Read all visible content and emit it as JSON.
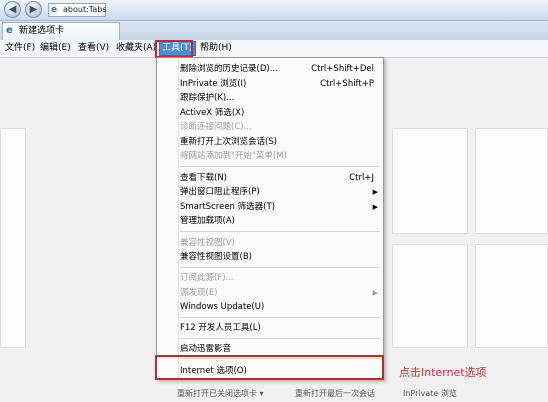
{
  "browser": {
    "address": "about:Tabs",
    "tab_title": "新建选项卡"
  },
  "menubar": {
    "items": [
      "文件(F)",
      "编辑(E)",
      "查看(V)",
      "收藏夹(A)",
      "工具(T)",
      "帮助(H)"
    ]
  },
  "tools_menu": {
    "items": [
      {
        "label": "删除浏览的历史记录(D)...",
        "shortcut": "Ctrl+Shift+Del",
        "disabled": false
      },
      {
        "label": "InPrivate 浏览(I)",
        "shortcut": "Ctrl+Shift+P",
        "disabled": false
      },
      {
        "label": "跟踪保护(K)...",
        "shortcut": "",
        "disabled": false
      },
      {
        "label": "ActiveX 筛选(X)",
        "shortcut": "",
        "disabled": false
      },
      {
        "label": "诊断连接问题(C)...",
        "shortcut": "",
        "disabled": true
      },
      {
        "label": "重新打开上次浏览会话(S)",
        "shortcut": "",
        "disabled": false
      },
      {
        "label": "将网站添加到\"开始\"菜单(M)",
        "shortcut": "",
        "disabled": true
      },
      {
        "label": "查看下载(N)",
        "shortcut": "Ctrl+J",
        "disabled": false
      },
      {
        "label": "弹出窗口阻止程序(P)",
        "shortcut": "",
        "disabled": false
      },
      {
        "label": "SmartScreen 筛选器(T)",
        "shortcut": "",
        "disabled": false
      },
      {
        "label": "管理加载项(A)",
        "shortcut": "",
        "disabled": false
      },
      {
        "label": "兼容性视图(V)",
        "shortcut": "",
        "disabled": true
      },
      {
        "label": "兼容性视图设置(B)",
        "shortcut": "",
        "disabled": false
      },
      {
        "label": "订阅此源(F)...",
        "shortcut": "",
        "disabled": true
      },
      {
        "label": "源发现(E)",
        "shortcut": "",
        "disabled": true
      },
      {
        "label": "Windows Update(U)",
        "shortcut": "",
        "disabled": false
      },
      {
        "label": "F12 开发人员工具(L)",
        "shortcut": "",
        "disabled": false
      },
      {
        "label": "启动迅雷影音",
        "shortcut": "",
        "disabled": false
      },
      {
        "label": "Internet 选项(O)",
        "shortcut": "",
        "disabled": false
      }
    ]
  },
  "annotation": "点击Internet选项",
  "bottom_links": {
    "reopen_closed_tabs": "重新打开已关闭选项卡 ▾",
    "reopen_last_session": "重新打开最后一次会话",
    "inprivate": "InPrivate 浏览"
  },
  "colors": {
    "highlight_box": "#c22a2a",
    "annotation": "#d03232",
    "menu_active": "#4a8ed8"
  }
}
